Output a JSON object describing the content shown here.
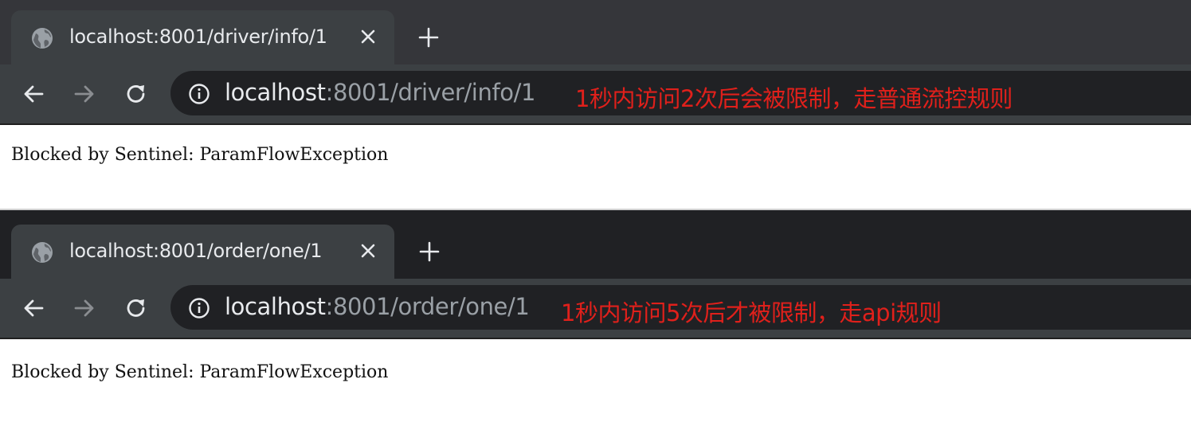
{
  "windows": [
    {
      "tab": {
        "title": "localhost:8001/driver/info/1",
        "icon": "globe-icon"
      },
      "address": {
        "host": "localhost",
        "rest": ":8001/driver/info/1"
      },
      "annotation": "1秒内访问2次后会被限制，走普通流控规则",
      "page_text": "Blocked by Sentinel: ParamFlowException"
    },
    {
      "tab": {
        "title": "localhost:8001/order/one/1",
        "icon": "globe-icon"
      },
      "address": {
        "host": "localhost",
        "rest": ":8001/order/one/1"
      },
      "annotation": "1秒内访问5次后才被限制，走api规则",
      "page_text": "Blocked by Sentinel: ParamFlowException"
    }
  ],
  "icons": [
    "globe-icon",
    "close-icon",
    "new-tab-icon",
    "back-icon",
    "forward-icon",
    "reload-icon",
    "info-icon"
  ],
  "colors": {
    "annotation": "#e0201b",
    "tab_active": "#3c4043",
    "toolbar": "#3c4043",
    "omnibox": "#202124"
  }
}
